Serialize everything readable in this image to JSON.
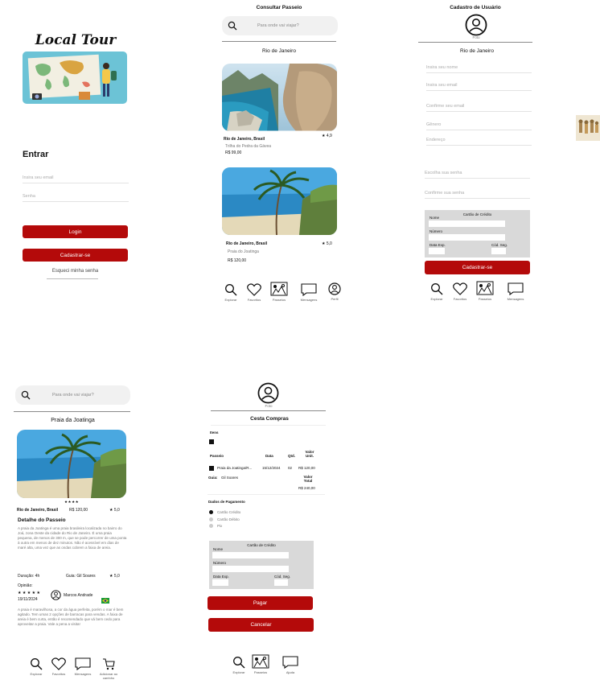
{
  "login": {
    "logo": "Local Tour",
    "title": "Entrar",
    "email_placeholder": "Insira seu email",
    "password_placeholder": "Senha",
    "login_label": "Login",
    "signup_label": "Cadastrar-se",
    "forgot_label": "Esqueci minha senha"
  },
  "consultar": {
    "title": "Consultar Passeio",
    "search_placeholder": "Para onde vai viajar?",
    "city": "Rio de Janeiro",
    "tours": [
      {
        "location": "Rio de Janeiro, Brasil",
        "rating": "★ 4,9",
        "name": "Trilha do Pedra da Gávea",
        "price": "R$ 99,00"
      },
      {
        "location": "Rio de Janeiro, Brasil",
        "rating": "★ 5,0",
        "name": "Praia do Joatinga",
        "price": "R$ 120,00"
      }
    ],
    "nav": [
      "Explorar",
      "Favoritos",
      "Passeios",
      "Mensagens",
      "Perfil"
    ]
  },
  "cadastro": {
    "title": "Cadastro de Usuário",
    "photo_label": "Foto",
    "city": "Rio de Janeiro",
    "fields": [
      "Insira seu nome",
      "Insira seu email",
      "Confirme seu email",
      "Gênero",
      "Endereço",
      "Escolha sua senha",
      "Confirme sua senha"
    ],
    "card_title": "Cartão de Crédito",
    "card_name": "Nome",
    "card_number": "Número",
    "card_exp": "Data Exp.",
    "card_cvv": "Cód. Seg.",
    "submit_label": "Cadastrar-se",
    "nav": [
      "Explorar",
      "Favoritos",
      "Passeios",
      "Mensagens"
    ]
  },
  "detalhe": {
    "search_placeholder": "Para onde vai viajar?",
    "title": "Praia da Joatinga",
    "stars": "★★★★",
    "location": "Rio de Janeiro, Brasil",
    "price": "R$ 120,00",
    "rating": "★ 5,0",
    "section_title": "Detalhe do Passeio",
    "description": "A praia da Joatinga é uma praia brasileira localizada no bairro do Joá, zona Oeste da cidade do Rio de Janeiro. É uma praia pequena, de menos de 300 m, que se pode percorrer de uma ponta à outra em menos de dez minutos. Não é acessível em dias de maré alta, uma vez que as ondas cobrem a faixa de areia.",
    "duration": "Duração: 4h",
    "guide": "Guia: Gil Soares",
    "guide_rating": "★ 5,0",
    "opinion_label": "Opinião:",
    "review_stars": "★ ★ ★ ★ ★",
    "review_date": "19/11/2024",
    "reviewer": "Marcos Andrade",
    "review_text": "A praia é maravilhosa, a cor da água perfeita, porém o mar é bem agitado. Tem umas 2 opções de barracas para vendas. A faixa de areia é bem curta, então é recomendado que vá bem cedo para aproveitar a praia. Vale a pena a visita!",
    "nav": [
      "Explorar",
      "Favoritos",
      "Mensagens",
      "Adicionar ao carrinho"
    ]
  },
  "cesta": {
    "photo_label": "Foto",
    "title": "Cesta Compras",
    "items_label": "Itens",
    "col_passeio": "Passeio",
    "col_data": "Data",
    "col_qtd": "Qtd.",
    "col_valor": "Valor Unit.",
    "row_name": "Praia da Joatinga/R...",
    "row_date": "15/12/2024",
    "row_qtd": "02",
    "row_valor": "R$ 120,00",
    "guide_label": "Guia:",
    "guide_name": "Gil Soares",
    "total_label": "Valor Total",
    "total_value": "R$ 240,00",
    "payment_title": "Dados de Pagamento",
    "payment_options": [
      "Cartão Crédito",
      "Cartão Débito",
      "Pix"
    ],
    "card_title": "Cartão de Crédito",
    "card_name": "Nome",
    "card_number": "Número",
    "card_exp": "Data Exp.",
    "card_cvv": "Cód. Seg.",
    "pay_label": "Pagar",
    "cancel_label": "Cancelar",
    "nav": [
      "Explorar",
      "Passeios",
      "Ajuda"
    ]
  },
  "colors": {
    "accent": "#b40a0a",
    "panel": "#d9d9d9",
    "search_bg": "#f1f1f1"
  }
}
